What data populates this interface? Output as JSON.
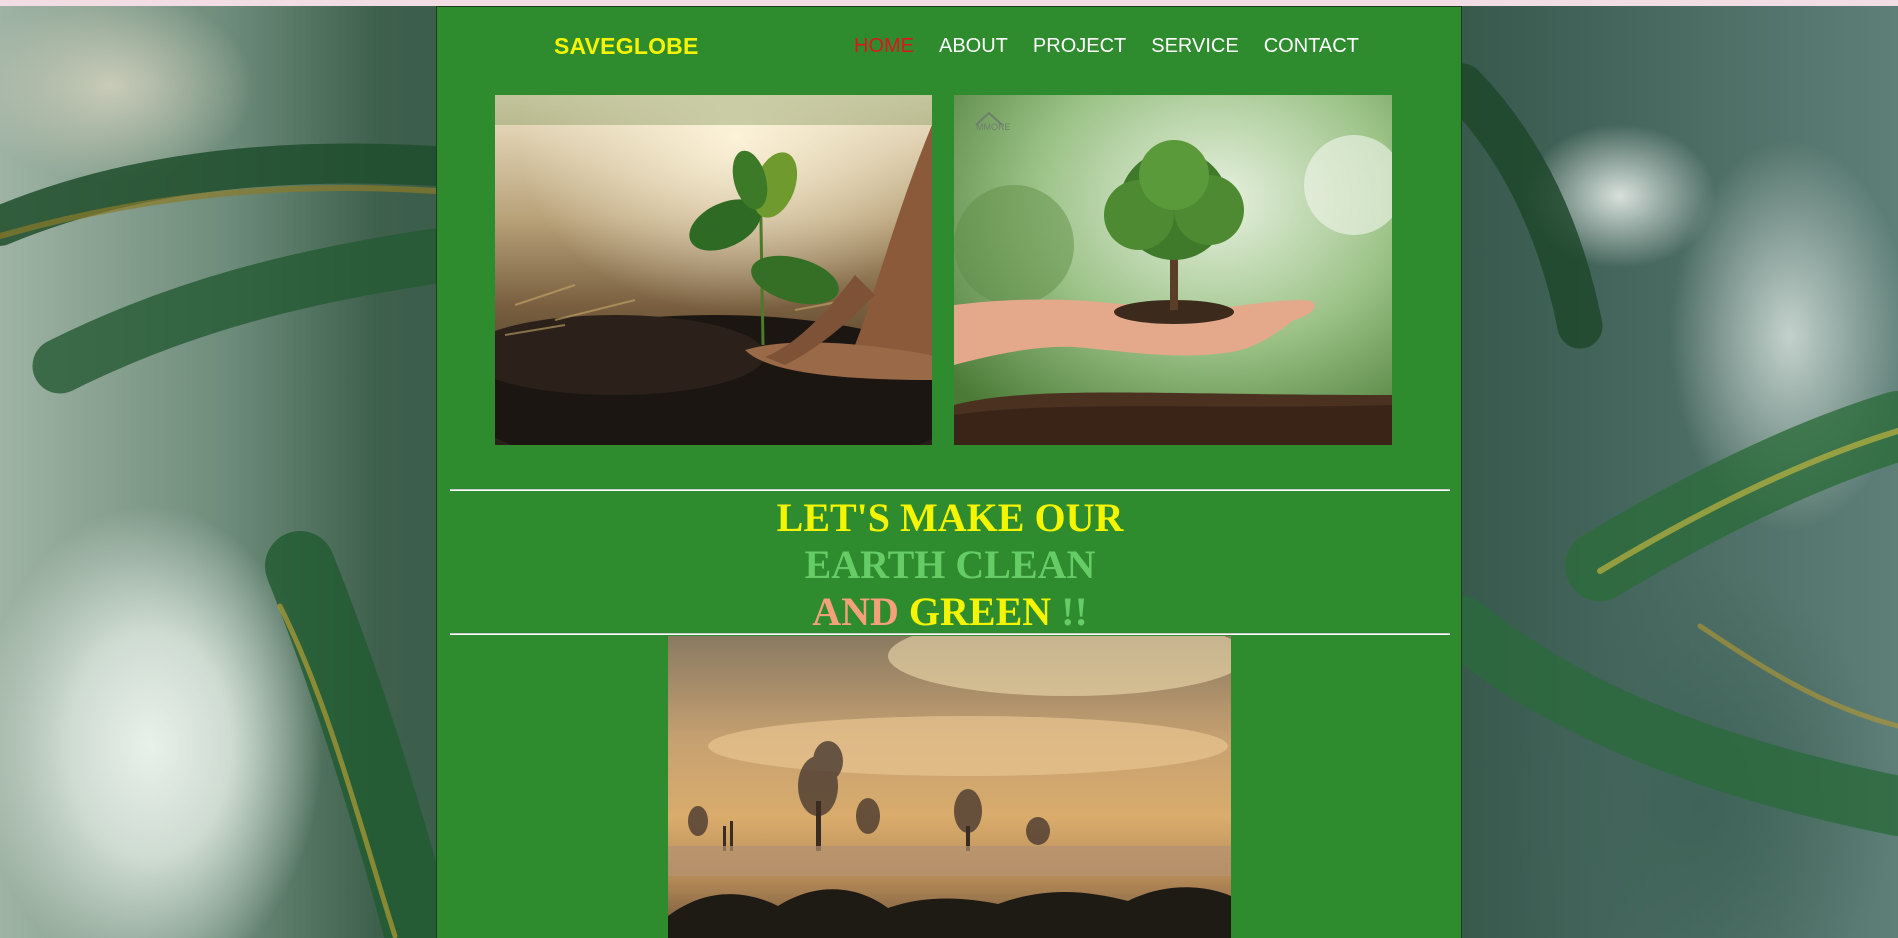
{
  "brand": {
    "name": "SAVEGLOBE"
  },
  "nav": {
    "items": [
      {
        "label": "HOME",
        "active": true
      },
      {
        "label": "ABOUT",
        "active": false
      },
      {
        "label": "PROJECT",
        "active": false
      },
      {
        "label": "SERVICE",
        "active": false
      },
      {
        "label": "CONTACT",
        "active": false
      }
    ]
  },
  "hero": {
    "line1": "LET'S MAKE OUR",
    "line2": "EARTH CLEAN",
    "line3_and": "AND",
    "line3_green": "GREEN",
    "line3_bang": "!!"
  },
  "images": {
    "left_photo": "seedling-planted-by-hands",
    "right_photo": "tree-held-in-palm",
    "right_photo_watermark": "MMORE",
    "bottom_photo": "factory-smoke-sunset"
  },
  "colors": {
    "page_panel": "#2e8b2e",
    "brand": "#f5f500",
    "nav_active": "#e0141f",
    "nav_text": "#ffffff",
    "headline_yellow": "#f5f500",
    "headline_green": "#66cc66",
    "headline_salmon": "#f4a179"
  }
}
